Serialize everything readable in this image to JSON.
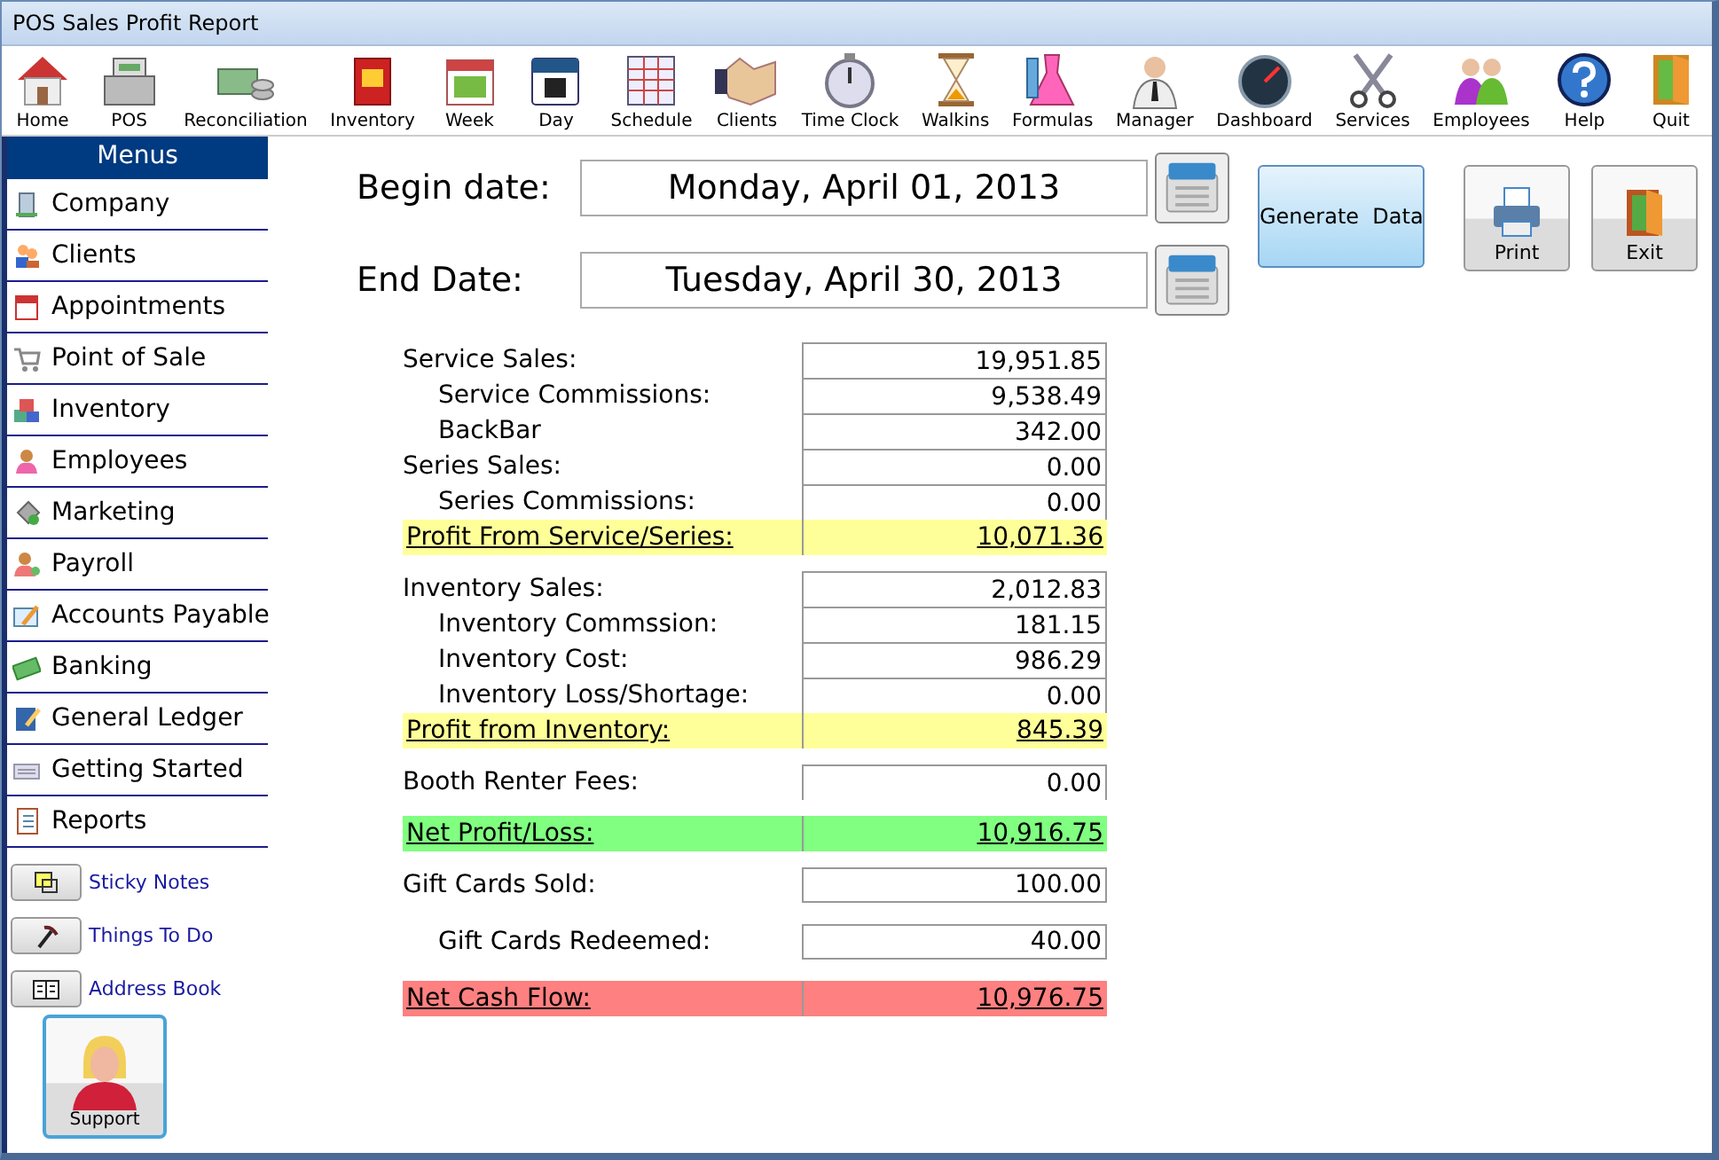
{
  "window": {
    "title": "POS Sales Profit Report"
  },
  "toolbar": [
    "Home",
    "POS",
    "Reconciliation",
    "Inventory",
    "Week",
    "Day",
    "Schedule",
    "Clients",
    "Time Clock",
    "Walkins",
    "Formulas",
    "Manager",
    "Dashboard",
    "Services",
    "Employees",
    "Help",
    "Quit"
  ],
  "sidebar": {
    "title": "Menus",
    "items": [
      "Company",
      "Clients",
      "Appointments",
      "Point of Sale",
      "Inventory",
      "Employees",
      "Marketing",
      "Payroll",
      "Accounts Payable",
      "Banking",
      "General Ledger",
      "Getting Started",
      "Reports"
    ],
    "links": [
      "Sticky Notes",
      "Things To Do",
      "Address Book"
    ],
    "support": "Support"
  },
  "dates": [
    {
      "label": "Begin date:",
      "value": "Monday, April 01, 2013"
    },
    {
      "label": "End Date:",
      "value": "Tuesday, April 30, 2013"
    }
  ],
  "actions": {
    "generate": "Generate  Data",
    "print": "Print",
    "exit": "Exit"
  },
  "report": [
    {
      "kind": "tight",
      "rows": [
        {
          "kind": "item",
          "label": "Service Sales:",
          "value": "19,951.85"
        },
        {
          "kind": "sub",
          "label": "Service Commissions:",
          "value": "9,538.49"
        },
        {
          "kind": "sub",
          "label": "BackBar",
          "value": "342.00"
        },
        {
          "kind": "item",
          "label": "Series Sales:",
          "value": "0.00"
        },
        {
          "kind": "sub",
          "label": "Series Commissions:",
          "value": "0.00"
        },
        {
          "kind": "total",
          "label": "Profit From Service/Series:",
          "value": "10,071.36",
          "color": "#ffff99"
        }
      ]
    },
    {
      "kind": "tight",
      "rows": [
        {
          "kind": "item",
          "label": "Inventory Sales:",
          "value": "2,012.83"
        },
        {
          "kind": "sub",
          "label": "Inventory Commssion:",
          "value": "181.15"
        },
        {
          "kind": "sub",
          "label": "Inventory Cost:",
          "value": "986.29"
        },
        {
          "kind": "sub",
          "label": "Inventory Loss/Shortage:",
          "value": "0.00"
        },
        {
          "kind": "total",
          "label": "Profit from Inventory:",
          "value": "845.39",
          "color": "#ffff99"
        }
      ]
    },
    {
      "kind": "tight",
      "rows": [
        {
          "kind": "item",
          "label": "Booth Renter Fees:",
          "value": "0.00"
        }
      ]
    },
    {
      "kind": "tight",
      "rows": [
        {
          "kind": "total",
          "label": "Net Profit/Loss:",
          "value": "10,916.75",
          "color": "#80ff80"
        }
      ]
    },
    {
      "kind": "spaced",
      "rows": [
        {
          "kind": "item",
          "label": "Gift Cards Sold:",
          "value": "100.00"
        },
        {
          "kind": "sub",
          "label": "Gift Cards Redeemed:",
          "value": "40.00"
        },
        {
          "kind": "total",
          "label": "Net Cash Flow:",
          "value": "10,976.75",
          "color": "#ff8080"
        }
      ]
    }
  ]
}
